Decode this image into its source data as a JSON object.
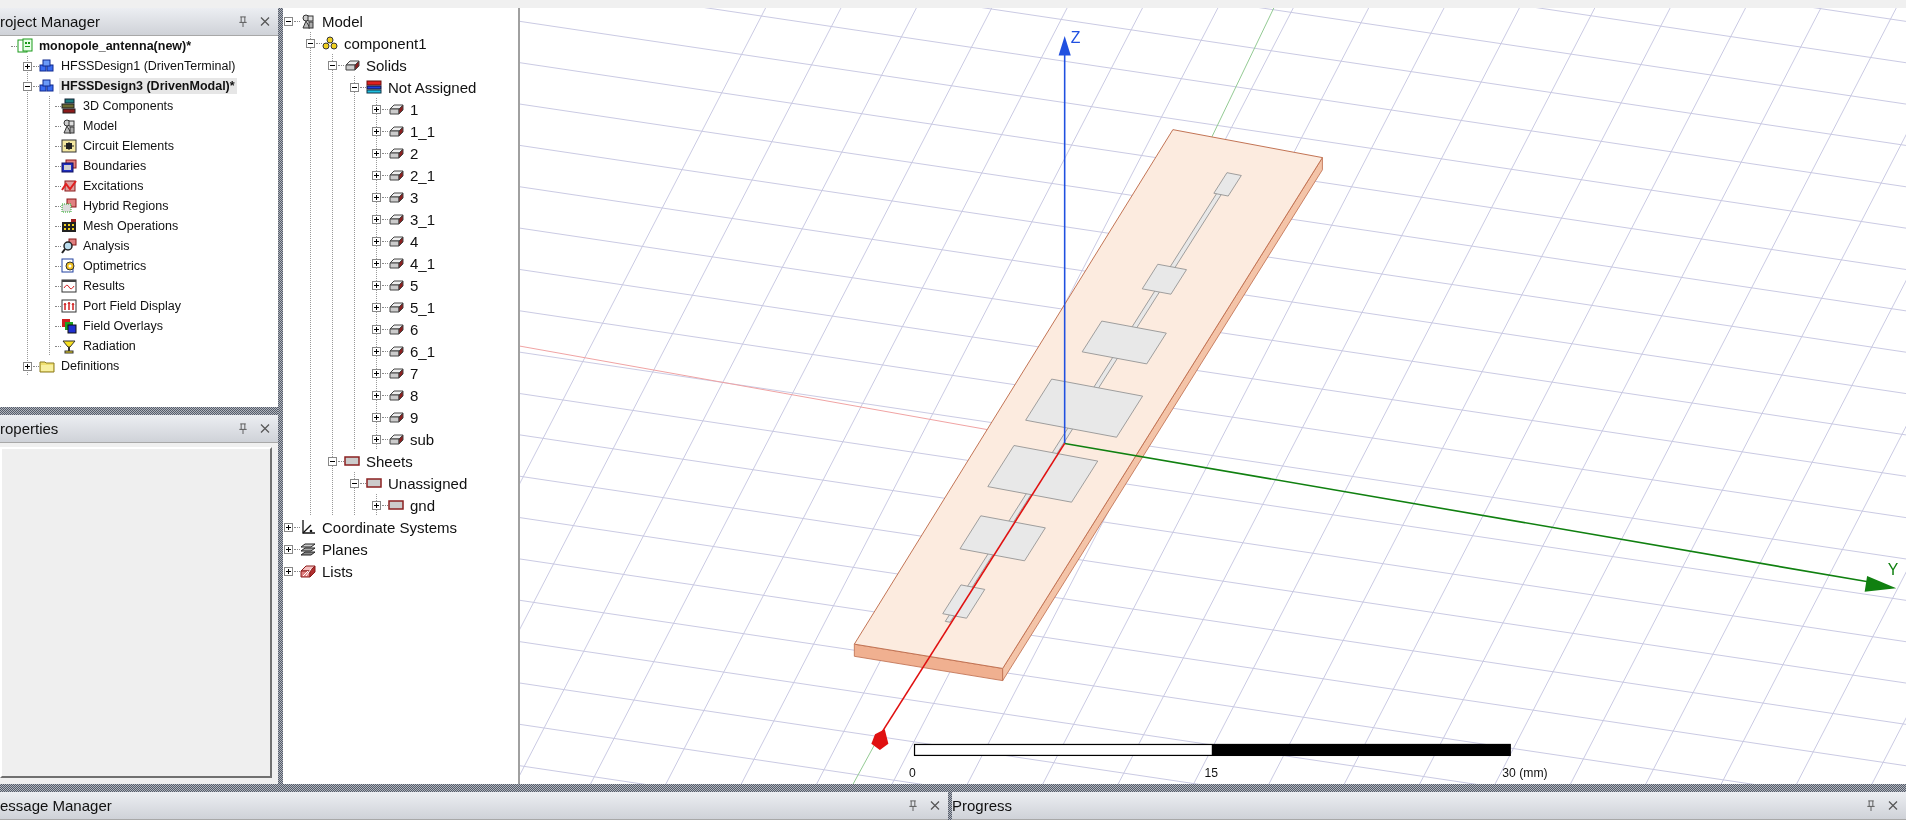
{
  "project_manager": {
    "title": "roject Manager",
    "tree": [
      {
        "label": "monopole_antenna(new)*",
        "kind": "project",
        "bold": true,
        "selected": false,
        "children": [
          {
            "label": "HFSSDesign1 (DrivenTerminal)",
            "kind": "design",
            "bold": false,
            "selected": false,
            "expanded": false
          },
          {
            "label": "HFSSDesign3 (DrivenModal)*",
            "kind": "design",
            "bold": true,
            "selected": true,
            "expanded": true,
            "children": [
              {
                "label": "3D Components",
                "kind": "components",
                "bold": false,
                "selected": false
              },
              {
                "label": "Model",
                "kind": "model",
                "bold": false,
                "selected": false
              },
              {
                "label": "Circuit Elements",
                "kind": "circuit",
                "bold": false,
                "selected": false
              },
              {
                "label": "Boundaries",
                "kind": "boundaries",
                "bold": false,
                "selected": false
              },
              {
                "label": "Excitations",
                "kind": "excitations",
                "bold": false,
                "selected": false
              },
              {
                "label": "Hybrid Regions",
                "kind": "hybrid",
                "bold": false,
                "selected": false
              },
              {
                "label": "Mesh Operations",
                "kind": "mesh",
                "bold": false,
                "selected": false
              },
              {
                "label": "Analysis",
                "kind": "analysis",
                "bold": false,
                "selected": false
              },
              {
                "label": "Optimetrics",
                "kind": "optimetrics",
                "bold": false,
                "selected": false
              },
              {
                "label": "Results",
                "kind": "results",
                "bold": false,
                "selected": false
              },
              {
                "label": "Port Field Display",
                "kind": "portfield",
                "bold": false,
                "selected": false
              },
              {
                "label": "Field Overlays",
                "kind": "overlays",
                "bold": false,
                "selected": false
              },
              {
                "label": "Radiation",
                "kind": "radiation",
                "bold": false,
                "selected": false
              }
            ]
          },
          {
            "label": "Definitions",
            "kind": "folder",
            "bold": false,
            "selected": false,
            "expanded": false
          }
        ]
      }
    ]
  },
  "properties": {
    "title": "roperties"
  },
  "model_tree": [
    {
      "label": "Model",
      "kind": "model",
      "expanded": true,
      "children": [
        {
          "label": "component1",
          "kind": "group",
          "expanded": true,
          "children": [
            {
              "label": "Solids",
              "kind": "solid",
              "expanded": true,
              "children": [
                {
                  "label": "Not Assigned",
                  "kind": "material",
                  "expanded": true,
                  "children": [
                    {
                      "label": "1",
                      "kind": "solid",
                      "expanded": false
                    },
                    {
                      "label": "1_1",
                      "kind": "solid",
                      "expanded": false
                    },
                    {
                      "label": "2",
                      "kind": "solid",
                      "expanded": false
                    },
                    {
                      "label": "2_1",
                      "kind": "solid",
                      "expanded": false
                    },
                    {
                      "label": "3",
                      "kind": "solid",
                      "expanded": false
                    },
                    {
                      "label": "3_1",
                      "kind": "solid",
                      "expanded": false
                    },
                    {
                      "label": "4",
                      "kind": "solid",
                      "expanded": false
                    },
                    {
                      "label": "4_1",
                      "kind": "solid",
                      "expanded": false
                    },
                    {
                      "label": "5",
                      "kind": "solid",
                      "expanded": false
                    },
                    {
                      "label": "5_1",
                      "kind": "solid",
                      "expanded": false
                    },
                    {
                      "label": "6",
                      "kind": "solid",
                      "expanded": false
                    },
                    {
                      "label": "6_1",
                      "kind": "solid",
                      "expanded": false
                    },
                    {
                      "label": "7",
                      "kind": "solid",
                      "expanded": false
                    },
                    {
                      "label": "8",
                      "kind": "solid",
                      "expanded": false
                    },
                    {
                      "label": "9",
                      "kind": "solid",
                      "expanded": false
                    },
                    {
                      "label": "sub",
                      "kind": "solid",
                      "expanded": false
                    }
                  ]
                }
              ]
            },
            {
              "label": "Sheets",
              "kind": "sheet",
              "expanded": true,
              "children": [
                {
                  "label": "Unassigned",
                  "kind": "sheet",
                  "expanded": true,
                  "children": [
                    {
                      "label": "gnd",
                      "kind": "sheet",
                      "expanded": false
                    }
                  ]
                }
              ]
            }
          ]
        }
      ]
    },
    {
      "label": "Coordinate Systems",
      "kind": "coords",
      "expanded": false
    },
    {
      "label": "Planes",
      "kind": "planes",
      "expanded": false
    },
    {
      "label": "Lists",
      "kind": "lists",
      "expanded": false
    }
  ],
  "viewport": {
    "axes": [
      {
        "kind": "z",
        "label": "Z"
      },
      {
        "kind": "y",
        "label": "Y"
      },
      {
        "kind": "x"
      }
    ],
    "scale_bar": {
      "labels": [
        "0",
        "15",
        "30 (mm)"
      ]
    }
  },
  "panels": [
    {
      "title": "essage Manager"
    },
    {
      "title": "Progress"
    }
  ]
}
